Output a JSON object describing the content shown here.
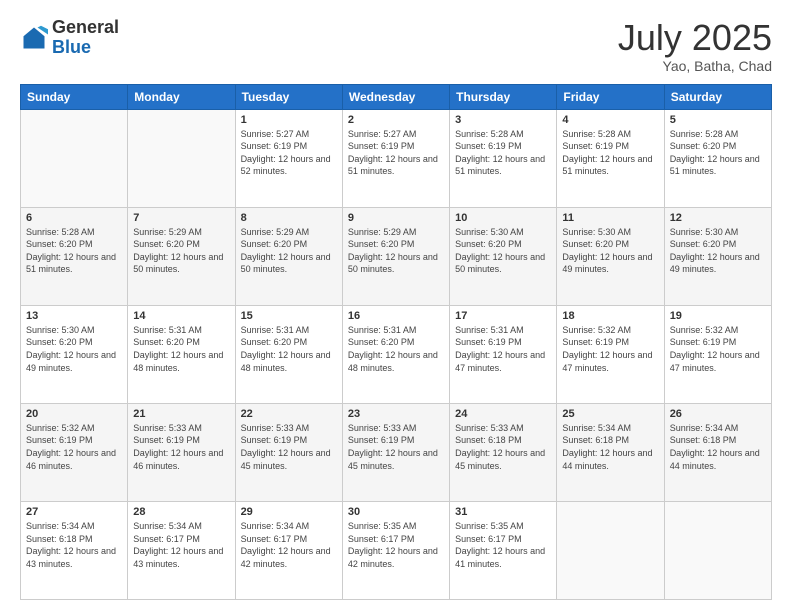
{
  "header": {
    "logo_general": "General",
    "logo_blue": "Blue",
    "month_title": "July 2025",
    "location": "Yao, Batha, Chad"
  },
  "days_of_week": [
    "Sunday",
    "Monday",
    "Tuesday",
    "Wednesday",
    "Thursday",
    "Friday",
    "Saturday"
  ],
  "weeks": [
    [
      {
        "day": "",
        "info": ""
      },
      {
        "day": "",
        "info": ""
      },
      {
        "day": "1",
        "info": "Sunrise: 5:27 AM\nSunset: 6:19 PM\nDaylight: 12 hours and 52 minutes."
      },
      {
        "day": "2",
        "info": "Sunrise: 5:27 AM\nSunset: 6:19 PM\nDaylight: 12 hours and 51 minutes."
      },
      {
        "day": "3",
        "info": "Sunrise: 5:28 AM\nSunset: 6:19 PM\nDaylight: 12 hours and 51 minutes."
      },
      {
        "day": "4",
        "info": "Sunrise: 5:28 AM\nSunset: 6:19 PM\nDaylight: 12 hours and 51 minutes."
      },
      {
        "day": "5",
        "info": "Sunrise: 5:28 AM\nSunset: 6:20 PM\nDaylight: 12 hours and 51 minutes."
      }
    ],
    [
      {
        "day": "6",
        "info": "Sunrise: 5:28 AM\nSunset: 6:20 PM\nDaylight: 12 hours and 51 minutes."
      },
      {
        "day": "7",
        "info": "Sunrise: 5:29 AM\nSunset: 6:20 PM\nDaylight: 12 hours and 50 minutes."
      },
      {
        "day": "8",
        "info": "Sunrise: 5:29 AM\nSunset: 6:20 PM\nDaylight: 12 hours and 50 minutes."
      },
      {
        "day": "9",
        "info": "Sunrise: 5:29 AM\nSunset: 6:20 PM\nDaylight: 12 hours and 50 minutes."
      },
      {
        "day": "10",
        "info": "Sunrise: 5:30 AM\nSunset: 6:20 PM\nDaylight: 12 hours and 50 minutes."
      },
      {
        "day": "11",
        "info": "Sunrise: 5:30 AM\nSunset: 6:20 PM\nDaylight: 12 hours and 49 minutes."
      },
      {
        "day": "12",
        "info": "Sunrise: 5:30 AM\nSunset: 6:20 PM\nDaylight: 12 hours and 49 minutes."
      }
    ],
    [
      {
        "day": "13",
        "info": "Sunrise: 5:30 AM\nSunset: 6:20 PM\nDaylight: 12 hours and 49 minutes."
      },
      {
        "day": "14",
        "info": "Sunrise: 5:31 AM\nSunset: 6:20 PM\nDaylight: 12 hours and 48 minutes."
      },
      {
        "day": "15",
        "info": "Sunrise: 5:31 AM\nSunset: 6:20 PM\nDaylight: 12 hours and 48 minutes."
      },
      {
        "day": "16",
        "info": "Sunrise: 5:31 AM\nSunset: 6:20 PM\nDaylight: 12 hours and 48 minutes."
      },
      {
        "day": "17",
        "info": "Sunrise: 5:31 AM\nSunset: 6:19 PM\nDaylight: 12 hours and 47 minutes."
      },
      {
        "day": "18",
        "info": "Sunrise: 5:32 AM\nSunset: 6:19 PM\nDaylight: 12 hours and 47 minutes."
      },
      {
        "day": "19",
        "info": "Sunrise: 5:32 AM\nSunset: 6:19 PM\nDaylight: 12 hours and 47 minutes."
      }
    ],
    [
      {
        "day": "20",
        "info": "Sunrise: 5:32 AM\nSunset: 6:19 PM\nDaylight: 12 hours and 46 minutes."
      },
      {
        "day": "21",
        "info": "Sunrise: 5:33 AM\nSunset: 6:19 PM\nDaylight: 12 hours and 46 minutes."
      },
      {
        "day": "22",
        "info": "Sunrise: 5:33 AM\nSunset: 6:19 PM\nDaylight: 12 hours and 45 minutes."
      },
      {
        "day": "23",
        "info": "Sunrise: 5:33 AM\nSunset: 6:19 PM\nDaylight: 12 hours and 45 minutes."
      },
      {
        "day": "24",
        "info": "Sunrise: 5:33 AM\nSunset: 6:18 PM\nDaylight: 12 hours and 45 minutes."
      },
      {
        "day": "25",
        "info": "Sunrise: 5:34 AM\nSunset: 6:18 PM\nDaylight: 12 hours and 44 minutes."
      },
      {
        "day": "26",
        "info": "Sunrise: 5:34 AM\nSunset: 6:18 PM\nDaylight: 12 hours and 44 minutes."
      }
    ],
    [
      {
        "day": "27",
        "info": "Sunrise: 5:34 AM\nSunset: 6:18 PM\nDaylight: 12 hours and 43 minutes."
      },
      {
        "day": "28",
        "info": "Sunrise: 5:34 AM\nSunset: 6:17 PM\nDaylight: 12 hours and 43 minutes."
      },
      {
        "day": "29",
        "info": "Sunrise: 5:34 AM\nSunset: 6:17 PM\nDaylight: 12 hours and 42 minutes."
      },
      {
        "day": "30",
        "info": "Sunrise: 5:35 AM\nSunset: 6:17 PM\nDaylight: 12 hours and 42 minutes."
      },
      {
        "day": "31",
        "info": "Sunrise: 5:35 AM\nSunset: 6:17 PM\nDaylight: 12 hours and 41 minutes."
      },
      {
        "day": "",
        "info": ""
      },
      {
        "day": "",
        "info": ""
      }
    ]
  ]
}
